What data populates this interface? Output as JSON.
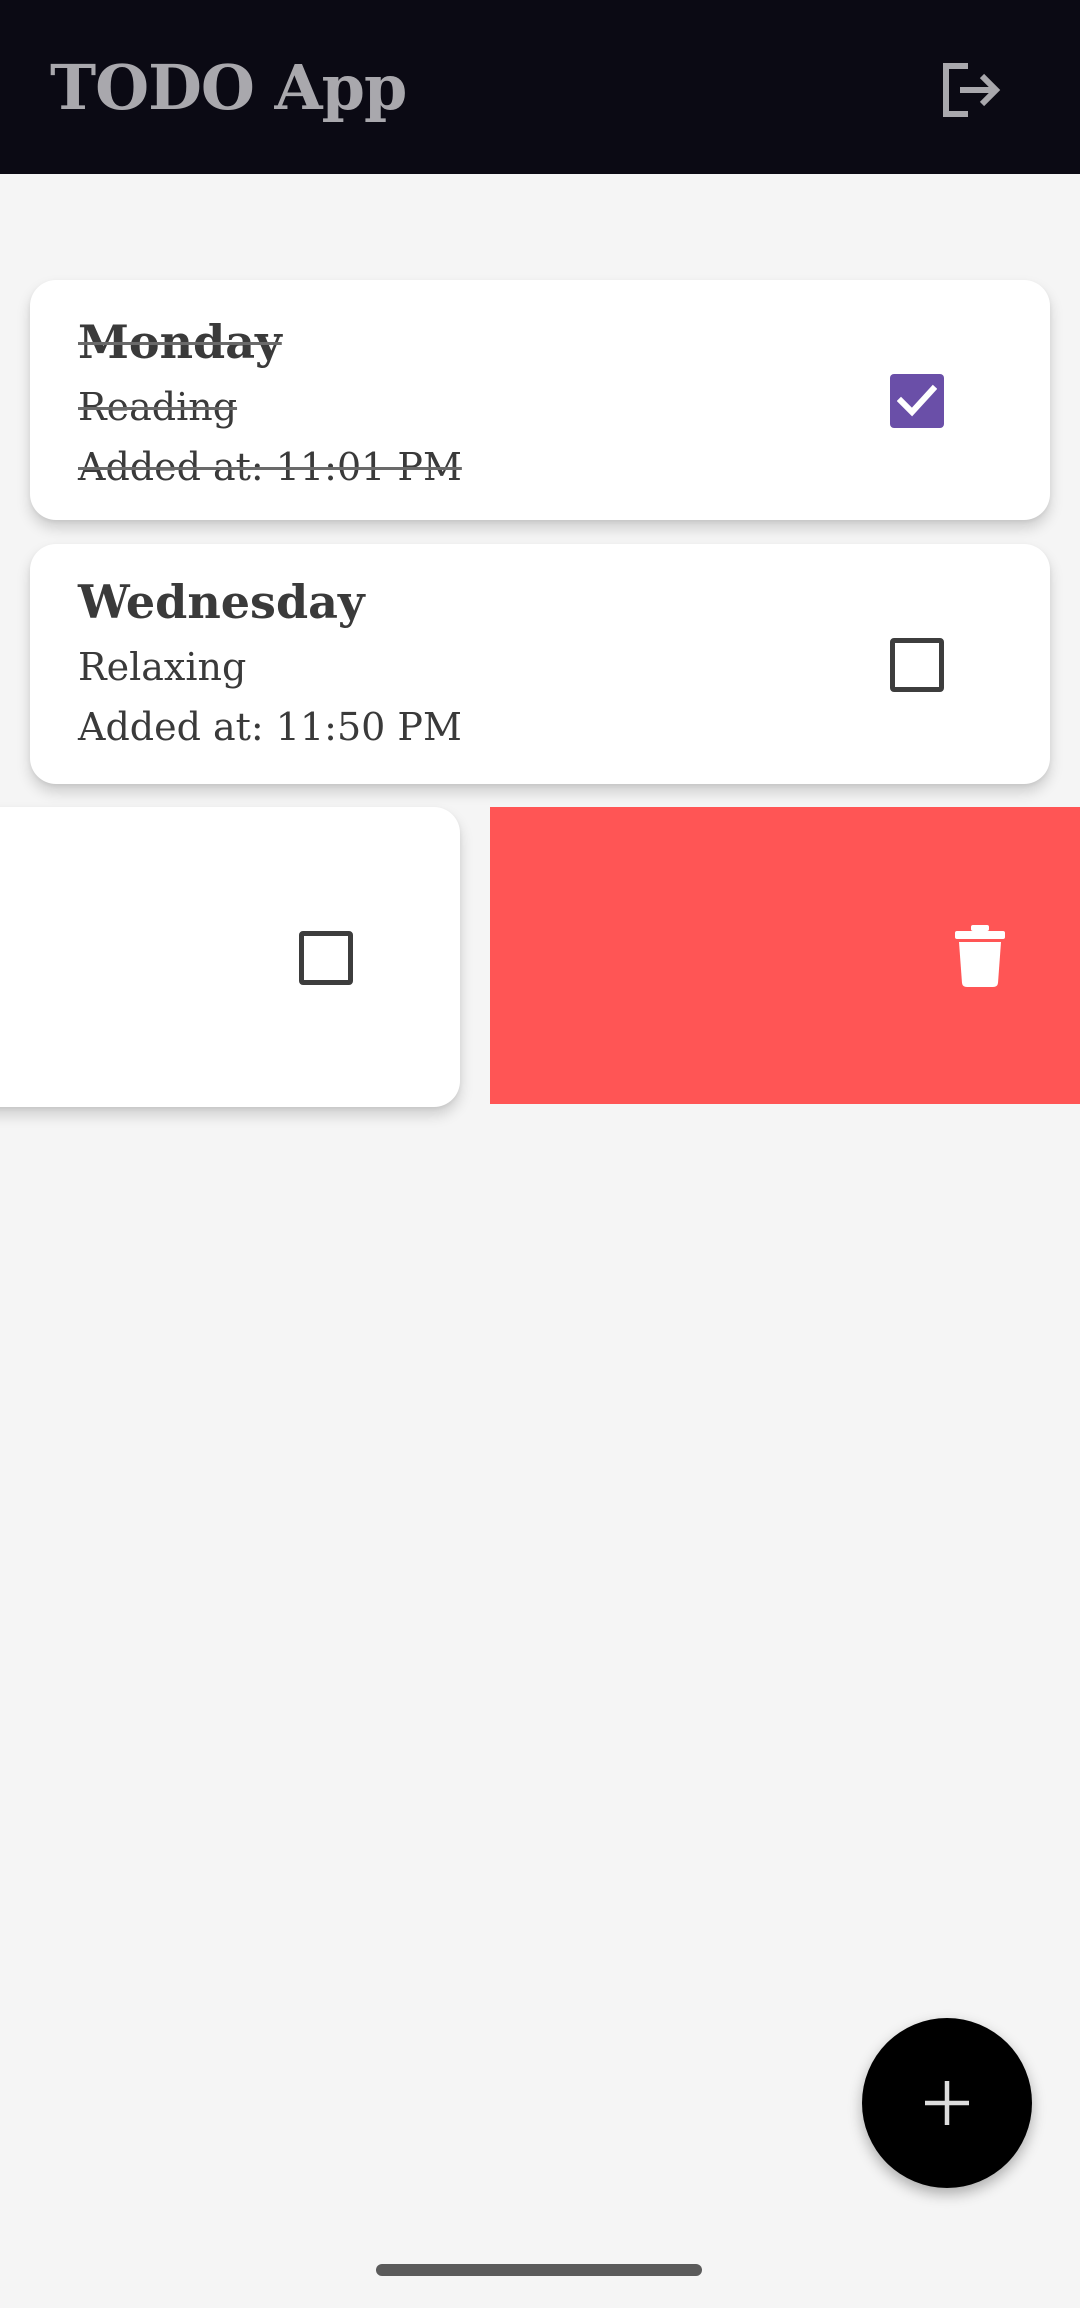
{
  "app_bar": {
    "title": "TODO App",
    "logout_icon": "logout-icon"
  },
  "todos": [
    {
      "title": "Monday",
      "description": "Reading",
      "added_at": "Added at: 11:01 PM",
      "completed": true
    },
    {
      "title": "Wednesday",
      "description": "Relaxing",
      "added_at": "Added at: 11:50 PM",
      "completed": false
    },
    {
      "title": "",
      "description": "",
      "added_at": "",
      "completed": false,
      "swiped": true
    }
  ],
  "swipe_action": {
    "icon": "trash-icon",
    "color": "#ff5555"
  },
  "fab": {
    "icon": "plus-icon"
  },
  "colors": {
    "app_bar": "#0b0a14",
    "title_text": "#a9a8ad",
    "checkbox_checked": "#6a4fa8",
    "background": "#f5f5f5",
    "delete": "#ff5555",
    "fab": "#000000"
  }
}
